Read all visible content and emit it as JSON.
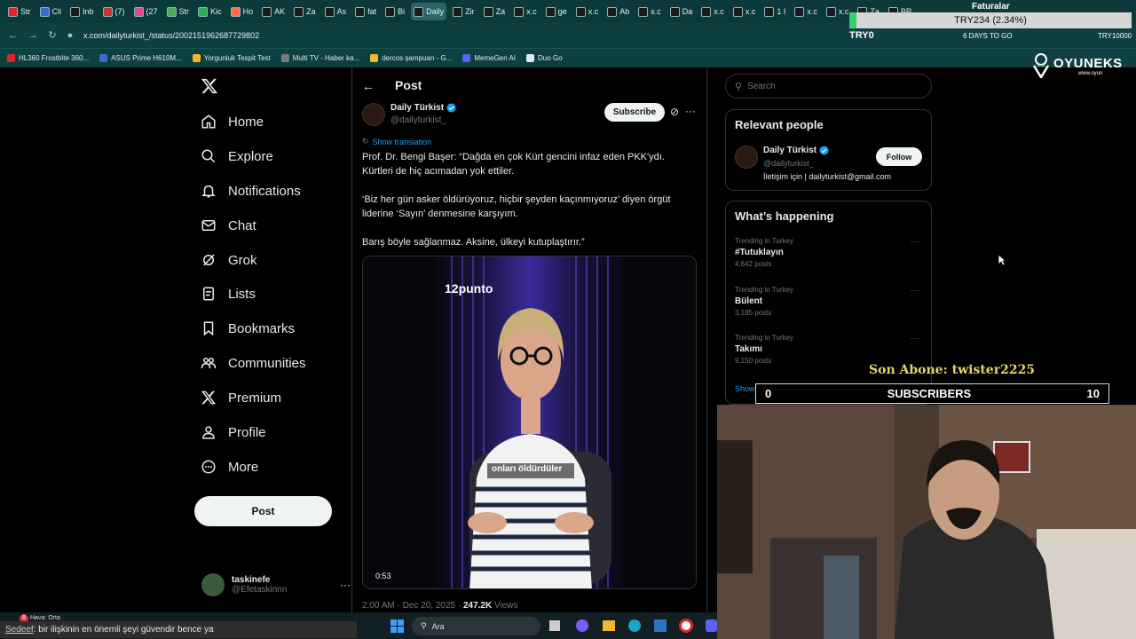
{
  "browser": {
    "tabs": [
      "Str",
      "Cli",
      "Inb",
      "(7)",
      "(27",
      "Str",
      "Kic",
      "Ho",
      "AK",
      "Za",
      "As",
      "fat",
      "Bi",
      "Daily",
      "Zir",
      "Za",
      "x.c",
      "ge",
      "x.c",
      "Ab",
      "x.c",
      "Da",
      "x.c",
      "x.c",
      "1 I",
      "x.c",
      "x.c",
      "Za",
      "BR"
    ],
    "url": "x.com/dailyturkist_/status/2002151962687729802",
    "bookmarks": [
      "HL360 Frostbite 360...",
      "ASUS Prime H610M...",
      "Yorgunluk Tespit Test",
      "Multi TV - Haber ka...",
      "dercos şampuan - G...",
      "MemeGen AI",
      "Duo Go"
    ]
  },
  "ticker": {
    "headline": "Faturalar",
    "value": "TRY234 (2.34%)",
    "left": "TRY0",
    "days": "6 DAYS TO GO",
    "right": "TRY10000"
  },
  "brand": {
    "logo_text": "OYUNEKS",
    "logo_sub": "www.oyun"
  },
  "nav": {
    "items": [
      "Home",
      "Explore",
      "Notifications",
      "Chat",
      "Grok",
      "Lists",
      "Bookmarks",
      "Communities",
      "Premium",
      "Profile",
      "More"
    ],
    "post_label": "Post"
  },
  "account": {
    "name": "taskinefe",
    "handle": "@Efetaskinnn"
  },
  "post": {
    "header_title": "Post",
    "author_name": "Daily Türkist",
    "author_handle": "@dailyturkist_",
    "subscribe": "Subscribe",
    "show_translation": "Show translation",
    "p1_line1": "Prof. Dr. Bengi Başer: “Dağda en çok Kürt gencini infaz eden PKK'ydı.",
    "p1_line2": "Kürtleri de hiç acımadan yok ettiler.",
    "p2_line1": "‘Biz her gün asker öldürüyoruz, hiçbir şeyden kaçınmıyoruz’ diyen örgüt",
    "p2_line2": "liderine ‘Sayın’ denmesine karşıyım.",
    "p3": "Barış böyle sağlanmaz. Aksine, ülkeyi kutuplaştırır.”",
    "video_watermark": "12punto",
    "video_caption": "onları öldürdüler",
    "video_time": "0:53",
    "meta_date": "2:00 AM · Dec 20, 2025 · ",
    "meta_views_count": "247.2K",
    "meta_views_label": " Views"
  },
  "sidebar": {
    "search_placeholder": "Search",
    "relevant_title": "Relevant people",
    "person_name": "Daily Türkist",
    "person_handle": "@dailyturkist_",
    "person_bio": "İletişim için | dailyturkist@gmail.com",
    "follow": "Follow",
    "happening_title": "What’s happening",
    "trends": [
      {
        "meta": "Trending in Turkey",
        "name": "#Tutuklayın",
        "posts": "4,642 posts"
      },
      {
        "meta": "Trending in Turkey",
        "name": "Bülent",
        "posts": "3,185 posts"
      },
      {
        "meta": "Trending in Turkey",
        "name": "Takımı",
        "posts": "9,150 posts"
      }
    ],
    "show_more": "Show more"
  },
  "overlay": {
    "last_sub": "Son Abone: twister2225",
    "subs_label": "SUBSCRIBERS",
    "subs_current": "0",
    "subs_goal": "10"
  },
  "chat_line": {
    "user": "Sedeef",
    "text": ": bir ilişkinin en önemli şeyi güvendir bence ya"
  },
  "taskbar": {
    "weather": "Hava: Orta",
    "badge": "8",
    "search": "Ara"
  },
  "colors": {
    "accent": "#1d9bf0",
    "chrome": "#0c3a3a",
    "overlay_gold": "#e8d36a"
  }
}
